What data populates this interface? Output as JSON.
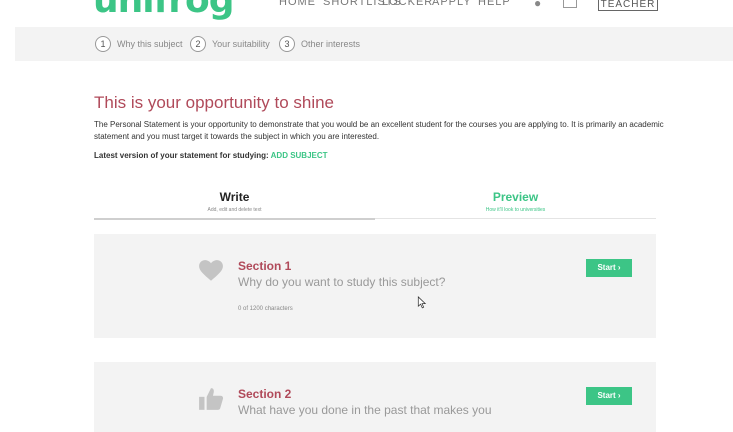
{
  "nav": {
    "logo": "unifrog",
    "links": [
      "HOME",
      "SHORTLISTS",
      "LOCKER",
      "APPLY",
      "HELP"
    ],
    "icons": [
      "bell-icon",
      "box-icon"
    ],
    "teacher_label": "TEACHER ›"
  },
  "steps": [
    {
      "num": "1",
      "label": "Why this subject"
    },
    {
      "num": "2",
      "label": "Your suitability"
    },
    {
      "num": "3",
      "label": "Other interests"
    }
  ],
  "intro": {
    "headline": "This is your opportunity to shine",
    "text": "The Personal Statement is your opportunity to demonstrate that you would be an excellent student for the courses you are applying to. It is primarily an academic statement and you must target it towards the subject in which you are interested.",
    "latest_label": "Latest version of your statement for studying:",
    "add_subject": "ADD SUBJECT"
  },
  "tabs": {
    "write": {
      "title": "Write",
      "sub": "Add, edit and delete text"
    },
    "preview": {
      "title": "Preview",
      "sub": "How it'll look to universities"
    }
  },
  "sections": [
    {
      "title": "Section 1",
      "question": "Why do you want to study this subject?",
      "count": "0 of 1200 characters",
      "start": "Start ›",
      "icon": "heart-icon"
    },
    {
      "title": "Section 2",
      "question": "What have you done in the past that makes you",
      "start": "Start ›",
      "icon": "thumbs-up-icon"
    }
  ],
  "colors": {
    "brand": "#3cc586",
    "accent": "#b04a5a",
    "panel": "#f3f3f3"
  }
}
